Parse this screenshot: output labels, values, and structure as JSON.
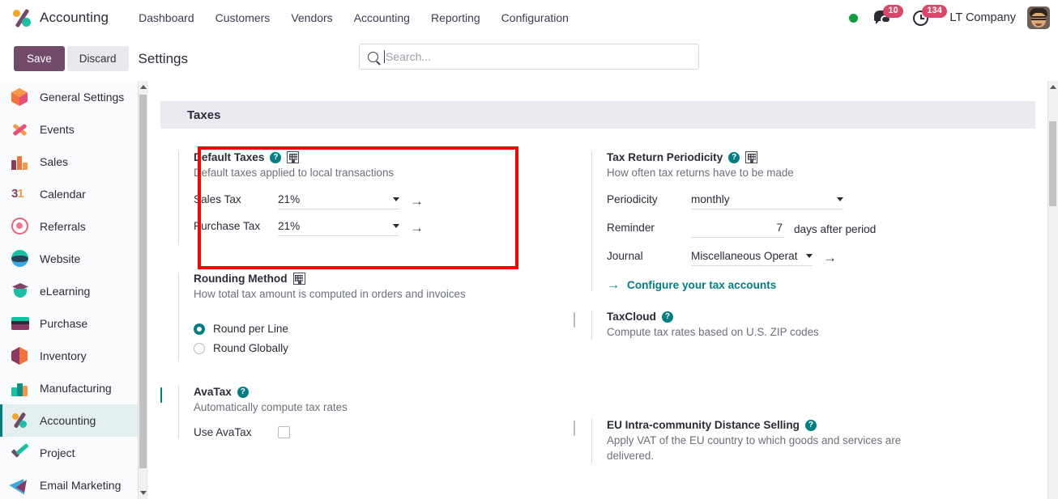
{
  "navbar": {
    "app_icon": "accounting-app-icon",
    "brand": "Accounting",
    "menu": [
      {
        "label": "Dashboard"
      },
      {
        "label": "Customers"
      },
      {
        "label": "Vendors"
      },
      {
        "label": "Accounting"
      },
      {
        "label": "Reporting"
      },
      {
        "label": "Configuration"
      }
    ],
    "status_dot_color": "#0e9f3c",
    "messages_badge": "10",
    "activities_badge": "134",
    "company": "LT Company",
    "avatar": "user-avatar"
  },
  "control_panel": {
    "save_label": "Save",
    "discard_label": "Discard",
    "title": "Settings"
  },
  "search": {
    "placeholder": "Search...",
    "value": ""
  },
  "sidebar": {
    "items": [
      {
        "label": "General Settings",
        "icon": "general-settings-icon",
        "active": false
      },
      {
        "label": "Events",
        "icon": "events-icon",
        "active": false
      },
      {
        "label": "Sales",
        "icon": "sales-icon",
        "active": false
      },
      {
        "label": "Calendar",
        "icon": "calendar-icon",
        "active": false
      },
      {
        "label": "Referrals",
        "icon": "referrals-icon",
        "active": false
      },
      {
        "label": "Website",
        "icon": "website-icon",
        "active": false
      },
      {
        "label": "eLearning",
        "icon": "elearning-icon",
        "active": false
      },
      {
        "label": "Purchase",
        "icon": "purchase-icon",
        "active": false
      },
      {
        "label": "Inventory",
        "icon": "inventory-icon",
        "active": false
      },
      {
        "label": "Manufacturing",
        "icon": "manufacturing-icon",
        "active": false
      },
      {
        "label": "Accounting",
        "icon": "accounting-icon",
        "active": true
      },
      {
        "label": "Project",
        "icon": "project-icon",
        "active": false
      },
      {
        "label": "Email Marketing",
        "icon": "email-marketing-icon",
        "active": false
      }
    ]
  },
  "section": {
    "title": "Taxes"
  },
  "settings": {
    "default_taxes": {
      "title": "Default Taxes",
      "description": "Default taxes applied to local transactions",
      "sales_tax_label": "Sales Tax",
      "sales_tax_value": "21%",
      "purchase_tax_label": "Purchase Tax",
      "purchase_tax_value": "21%"
    },
    "tax_return_periodicity": {
      "title": "Tax Return Periodicity",
      "description": "How often tax returns have to be made",
      "periodicity_label": "Periodicity",
      "periodicity_value": "monthly",
      "reminder_label": "Reminder",
      "reminder_value": "7",
      "reminder_suffix": "days after period",
      "journal_label": "Journal",
      "journal_value": "Miscellaneous Operat",
      "configure_link": "Configure your tax accounts"
    },
    "rounding_method": {
      "title": "Rounding Method",
      "description": "How total tax amount is computed in orders and invoices",
      "option_line": "Round per Line",
      "option_global": "Round Globally",
      "selected": "Round per Line"
    },
    "taxcloud": {
      "title": "TaxCloud",
      "description": "Compute tax rates based on U.S. ZIP codes",
      "checked": false
    },
    "avatax": {
      "title": "AvaTax",
      "description": "Automatically compute tax rates",
      "checked": true,
      "use_avatax_label": "Use AvaTax",
      "use_avatax_checked": false
    },
    "eu_distance_selling": {
      "title": "EU Intra-community Distance Selling",
      "description": "Apply VAT of the EU country to which goods and services are delivered.",
      "checked": false
    }
  },
  "annotation": {
    "highlight_color": "#fd0000",
    "target": "default-taxes-setting"
  },
  "colors": {
    "accent_teal": "#017e84",
    "brand_purple": "#714B67",
    "badge_red": "#d6496a"
  }
}
